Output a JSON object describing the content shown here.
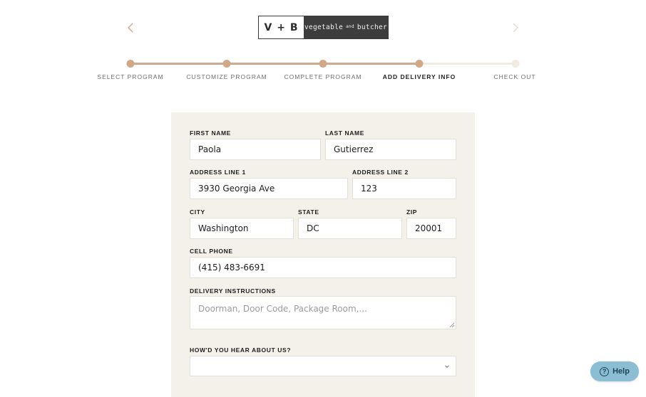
{
  "brand": {
    "mark": "V + B",
    "name_left": "vegetable",
    "name_amp": "and",
    "name_right": "butcher"
  },
  "nav": {
    "prev_icon": "chevron-left-icon",
    "next_icon": "chevron-right-icon"
  },
  "steps": [
    {
      "label": "SELECT PROGRAM",
      "state": "done"
    },
    {
      "label": "CUSTOMIZE PROGRAM",
      "state": "done"
    },
    {
      "label": "COMPLETE PROGRAM",
      "state": "done"
    },
    {
      "label": "ADD DELIVERY INFO",
      "state": "active"
    },
    {
      "label": "CHECK OUT",
      "state": "todo"
    }
  ],
  "form": {
    "first_name": {
      "label": "FIRST NAME",
      "value": "Paola"
    },
    "last_name": {
      "label": "LAST NAME",
      "value": "Gutierrez"
    },
    "address1": {
      "label": "ADDRESS LINE 1",
      "value": "3930 Georgia Ave"
    },
    "address2": {
      "label": "ADDRESS LINE 2",
      "value": "123"
    },
    "city": {
      "label": "CITY",
      "value": "Washington"
    },
    "state": {
      "label": "STATE",
      "value": "DC"
    },
    "zip": {
      "label": "ZIP",
      "value": "20001"
    },
    "phone": {
      "label": "CELL PHONE",
      "value": "(415) 483-6691"
    },
    "instructions": {
      "label": "DELIVERY INSTRUCTIONS",
      "value": "",
      "placeholder": "Doorman, Door Code, Package Room,..."
    },
    "referral": {
      "label": "HOW'D YOU HEAR ABOUT US?",
      "value": ""
    }
  },
  "help": {
    "label": "Help",
    "icon": "question-circle-icon"
  },
  "colors": {
    "accent": "#d2a887",
    "panel": "#f4f1ea",
    "help_bg": "#8bbdd3"
  }
}
